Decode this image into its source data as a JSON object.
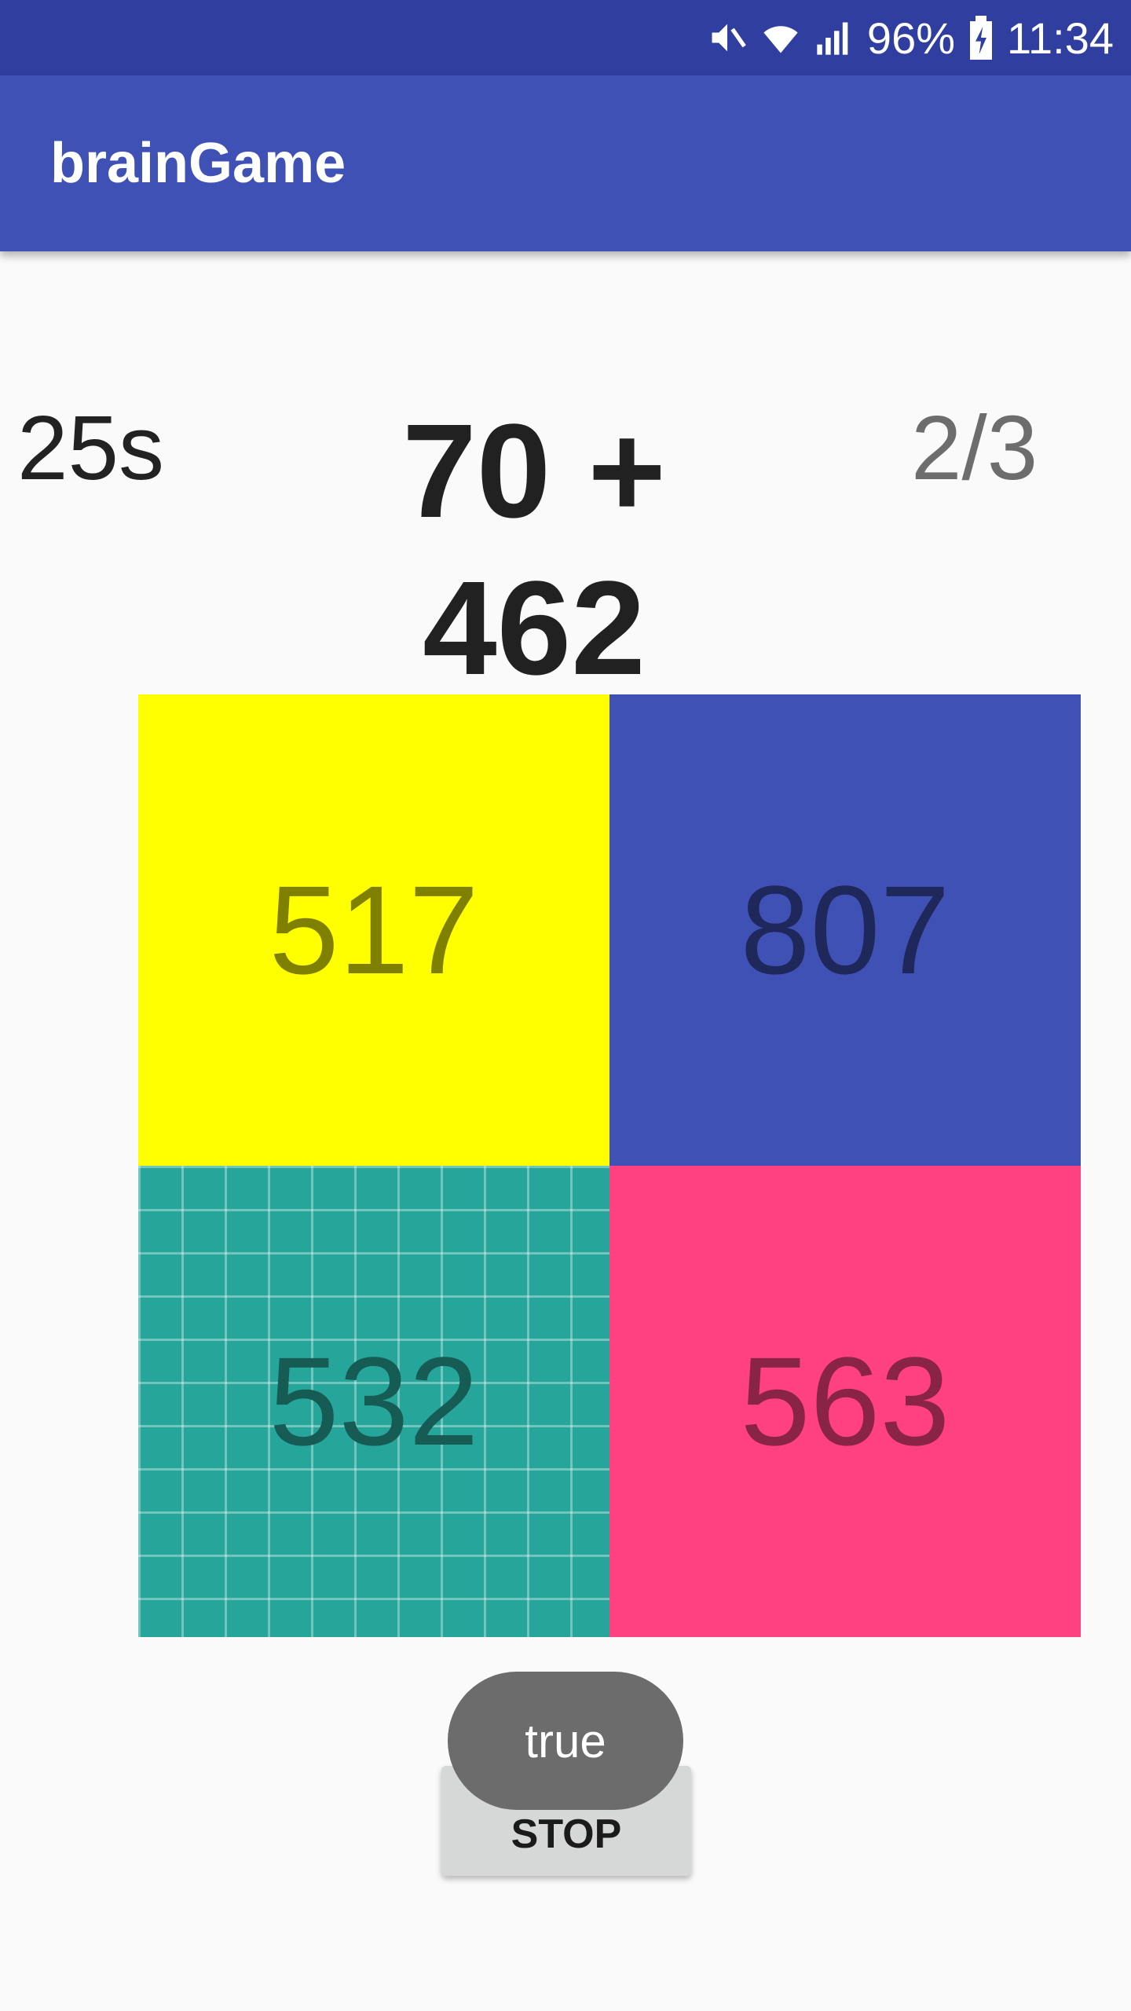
{
  "status_bar": {
    "battery": "96%",
    "time": "11:34",
    "icons": [
      "mute-icon",
      "wifi-icon",
      "signal-icon",
      "battery-charging-icon"
    ]
  },
  "app_bar": {
    "title": "brainGame"
  },
  "game": {
    "timer": "25s",
    "question": "70 + 462",
    "score": "2/3",
    "answers": [
      {
        "label": "517",
        "color": "#ffff00"
      },
      {
        "label": "807",
        "color": "#3f51b5"
      },
      {
        "label": "532",
        "color": "#26a69a"
      },
      {
        "label": "563",
        "color": "#ff4081"
      }
    ]
  },
  "controls": {
    "stop_label": "STOP"
  },
  "toast": {
    "message": "true"
  }
}
